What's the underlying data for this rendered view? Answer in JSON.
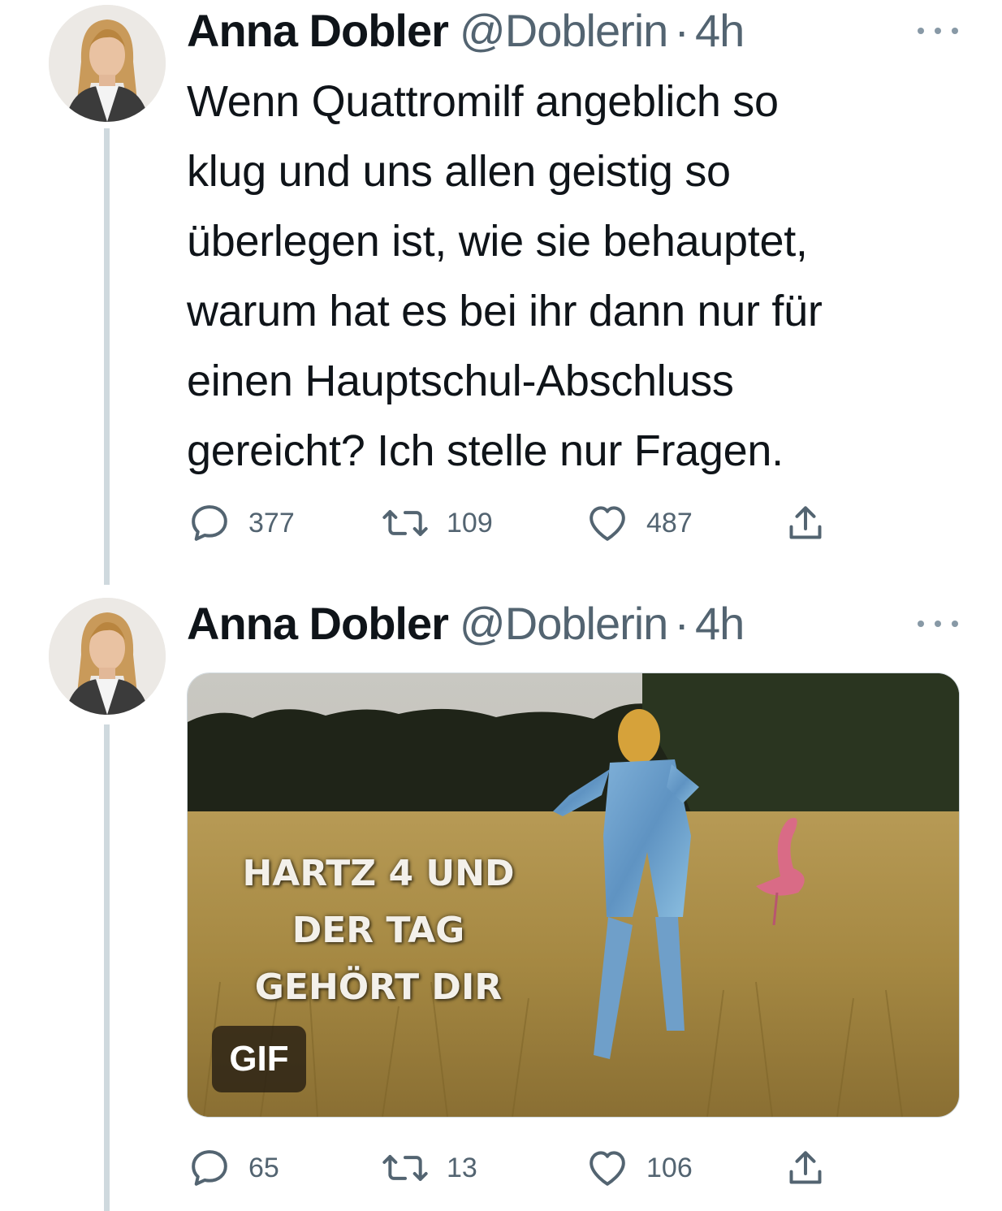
{
  "tweets": [
    {
      "author_name": "Anna Dobler",
      "handle": "@Doblerin",
      "separator": "·",
      "time": "4h",
      "text": "Wenn Quattromilf angeblich so\nklug und uns allen geistig so\nüberlegen ist, wie sie behauptet,\nwarum hat es bei ihr dann nur für\neinen Hauptschul-Abschluss\ngereicht? Ich stelle nur Fragen.",
      "actions": {
        "replies": "377",
        "retweets": "109",
        "likes": "487"
      }
    },
    {
      "author_name": "Anna Dobler",
      "handle": "@Doblerin",
      "separator": "·",
      "time": "4h",
      "media": {
        "overlay_text": "HARTZ 4 UND\nDER TAG\nGEHÖRT DIR",
        "badge": "GIF"
      },
      "actions": {
        "replies": "65",
        "retweets": "13",
        "likes": "106"
      }
    }
  ],
  "icons": {
    "reply": "reply-icon",
    "retweet": "retweet-icon",
    "like": "heart-icon",
    "share": "share-icon",
    "more": "more-icon"
  },
  "colors": {
    "text": "#0f1419",
    "secondary": "#536471",
    "thread_line": "#cfd9de"
  }
}
